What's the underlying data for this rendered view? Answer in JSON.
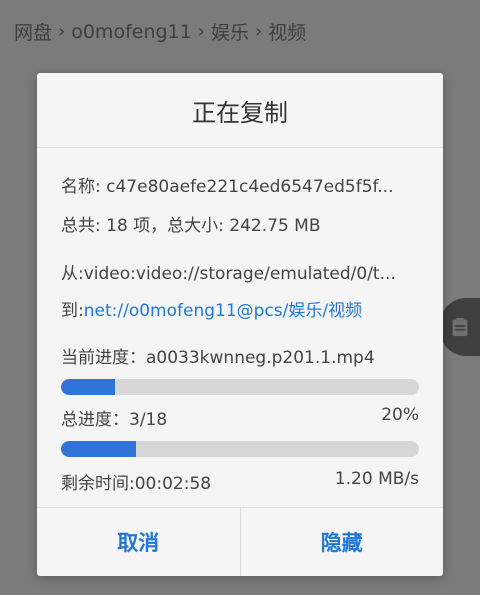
{
  "breadcrumb": [
    "网盘",
    "o0mofeng11",
    "娱乐",
    "视频"
  ],
  "dialog": {
    "title": "正在复制",
    "name_line": "名称: c47e80aefe221c4ed6547ed5f5f...",
    "total_line": "总共: 18 项，总大小: 242.75 MB",
    "from_line": "从:video:video://storage/emulated/0/t...",
    "to_label": "到:",
    "to_path": "net://o0mofeng11@pcs/娱乐/视频",
    "current_line": "当前进度：a0033kwnneg.p201.1.mp4",
    "current_progress": 0.15,
    "overall_label": "总进度：3/18",
    "overall_percent": "20%",
    "overall_progress": 0.21,
    "remaining_line": "剩余时间:00:02:58",
    "speed": "1.20 MB/s",
    "cancel_label": "取消",
    "hide_label": "隐藏"
  },
  "icons": {
    "side_button": "clipboard-icon"
  },
  "colors": {
    "accent": "#1f78d6",
    "progress": "#2f74d6",
    "dialog_bg": "#f5f5f5",
    "overlay": "#7b7b7b"
  }
}
